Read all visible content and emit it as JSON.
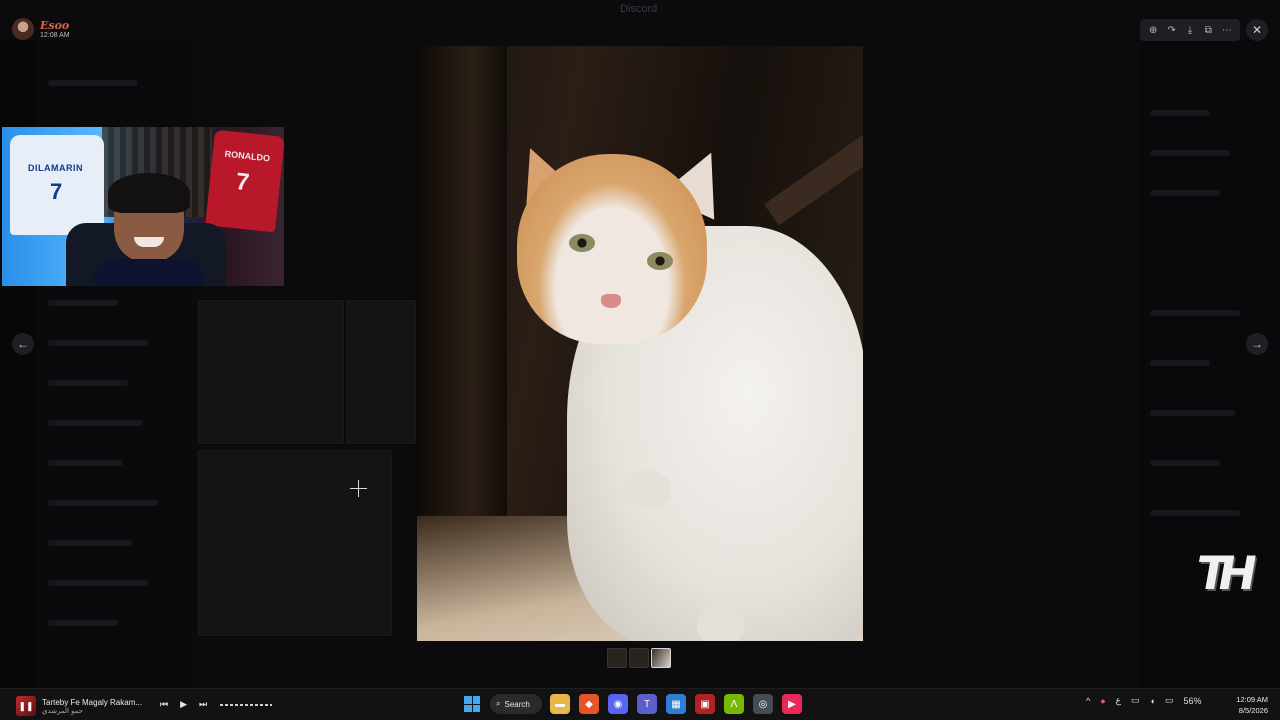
{
  "window": {
    "title": "Discord"
  },
  "user": {
    "name": "Esoo",
    "time": "12:08 AM"
  },
  "webcam": {
    "jersey_left_text": "DILAMARIN",
    "jersey_left_number": "7",
    "jersey_right_text": "RONALDO",
    "jersey_right_number": "7"
  },
  "viewer": {
    "toolbar": [
      {
        "name": "zoom-icon",
        "glyph": "⊕"
      },
      {
        "name": "forward-icon",
        "glyph": "↷"
      },
      {
        "name": "download-icon",
        "glyph": "⤓"
      },
      {
        "name": "open-external-icon",
        "glyph": "⧉"
      },
      {
        "name": "more-icon",
        "glyph": "⋯"
      }
    ],
    "close_glyph": "✕",
    "prev_glyph": "←",
    "next_glyph": "→",
    "thumbnail_count": 3,
    "active_thumbnail": 3
  },
  "watermark": {
    "text": "TH"
  },
  "taskbar": {
    "media": {
      "title": "Tarteby Fe Magaly Rakam...",
      "artist": "حمو المرشدي",
      "prev_glyph": "⏮",
      "play_glyph": "▶",
      "next_glyph": "⏭"
    },
    "search_label": "Search",
    "apps": [
      {
        "name": "file-explorer-icon",
        "color": "#e8b64a",
        "glyph": "▬"
      },
      {
        "name": "brave-browser-icon",
        "color": "#e8542a",
        "glyph": "◆"
      },
      {
        "name": "discord-icon",
        "color": "#5865f2",
        "glyph": "◉"
      },
      {
        "name": "teams-icon",
        "color": "#5b5fc7",
        "glyph": "T"
      },
      {
        "name": "store-icon",
        "color": "#2d7fd6",
        "glyph": "▦"
      },
      {
        "name": "streaming-app-icon",
        "color": "#b22222",
        "glyph": "▣"
      },
      {
        "name": "nvidia-icon",
        "color": "#76b900",
        "glyph": "Λ"
      },
      {
        "name": "steam-icon",
        "color": "#444c56",
        "glyph": "◎"
      },
      {
        "name": "media-player-icon",
        "color": "#e8295a",
        "glyph": "▶"
      }
    ],
    "tray": {
      "chevron_glyph": "^",
      "mic_glyph": "🎙",
      "language": "ع",
      "battery": "56%"
    },
    "clock": {
      "time": "12:09 AM",
      "date": "8/5/2026"
    }
  }
}
